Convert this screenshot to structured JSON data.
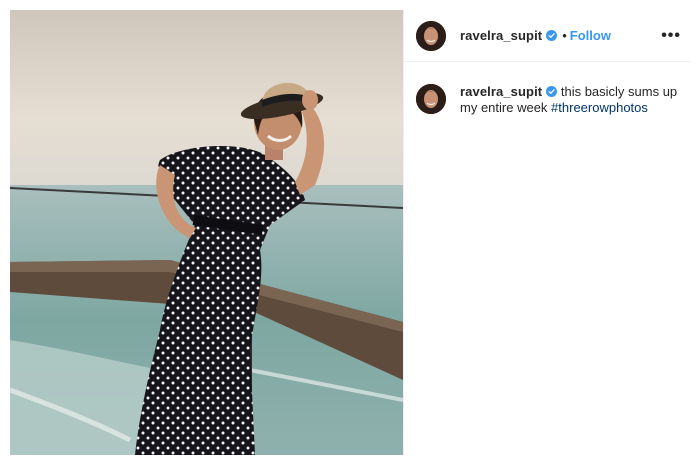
{
  "post": {
    "author": {
      "username": "ravelra_supit",
      "verified": true,
      "avatar_icon": "profile-avatar"
    },
    "header": {
      "separator": "•",
      "follow_label": "Follow",
      "more_icon": "ellipsis-icon",
      "more_label": "•••"
    },
    "caption": {
      "username": "ravelra_supit",
      "text": " this basicly sums up my entire week ",
      "hashtag": "#threerowphotos"
    },
    "colors": {
      "follow_blue": "#3897f0",
      "verified_blue": "#3897f0",
      "hashtag": "#003569",
      "text": "#262626"
    }
  }
}
